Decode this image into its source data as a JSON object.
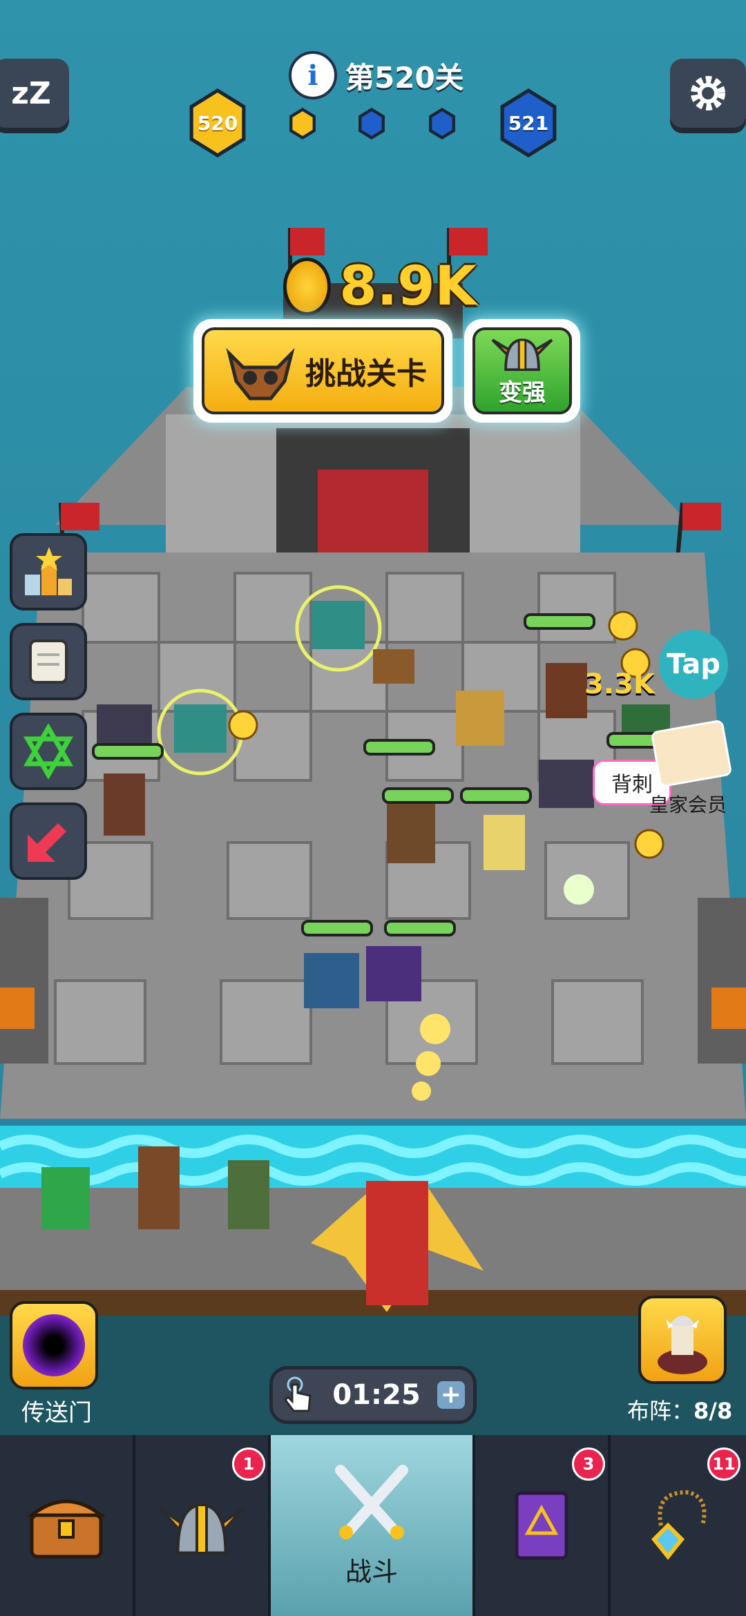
{
  "level": {
    "label": "第520关",
    "current": "520",
    "next": "521"
  },
  "coins": {
    "value": "8.9K"
  },
  "buttons": {
    "challenge": "挑战关卡",
    "upgrade": "变强",
    "portal": "传送门",
    "formation_label": "布阵：",
    "formation_count": "8/8"
  },
  "timer": {
    "value": "01:25",
    "plus": "+"
  },
  "side": {
    "tap": "Tap",
    "royal_member": "皇家会员",
    "backstab": "背刺",
    "floating_coins": "3.3K"
  },
  "nav": {
    "items": [
      {
        "name": "chest",
        "badge": ""
      },
      {
        "name": "helmet",
        "badge": "1"
      },
      {
        "name": "battle",
        "label": "战斗"
      },
      {
        "name": "spellbook",
        "badge": "3"
      },
      {
        "name": "amulet",
        "badge": "11"
      }
    ]
  },
  "colors": {
    "gold": "#f7c21d",
    "blue": "#1f5fc9",
    "teal": "#2fb3bf",
    "badge": "#e8244f"
  }
}
